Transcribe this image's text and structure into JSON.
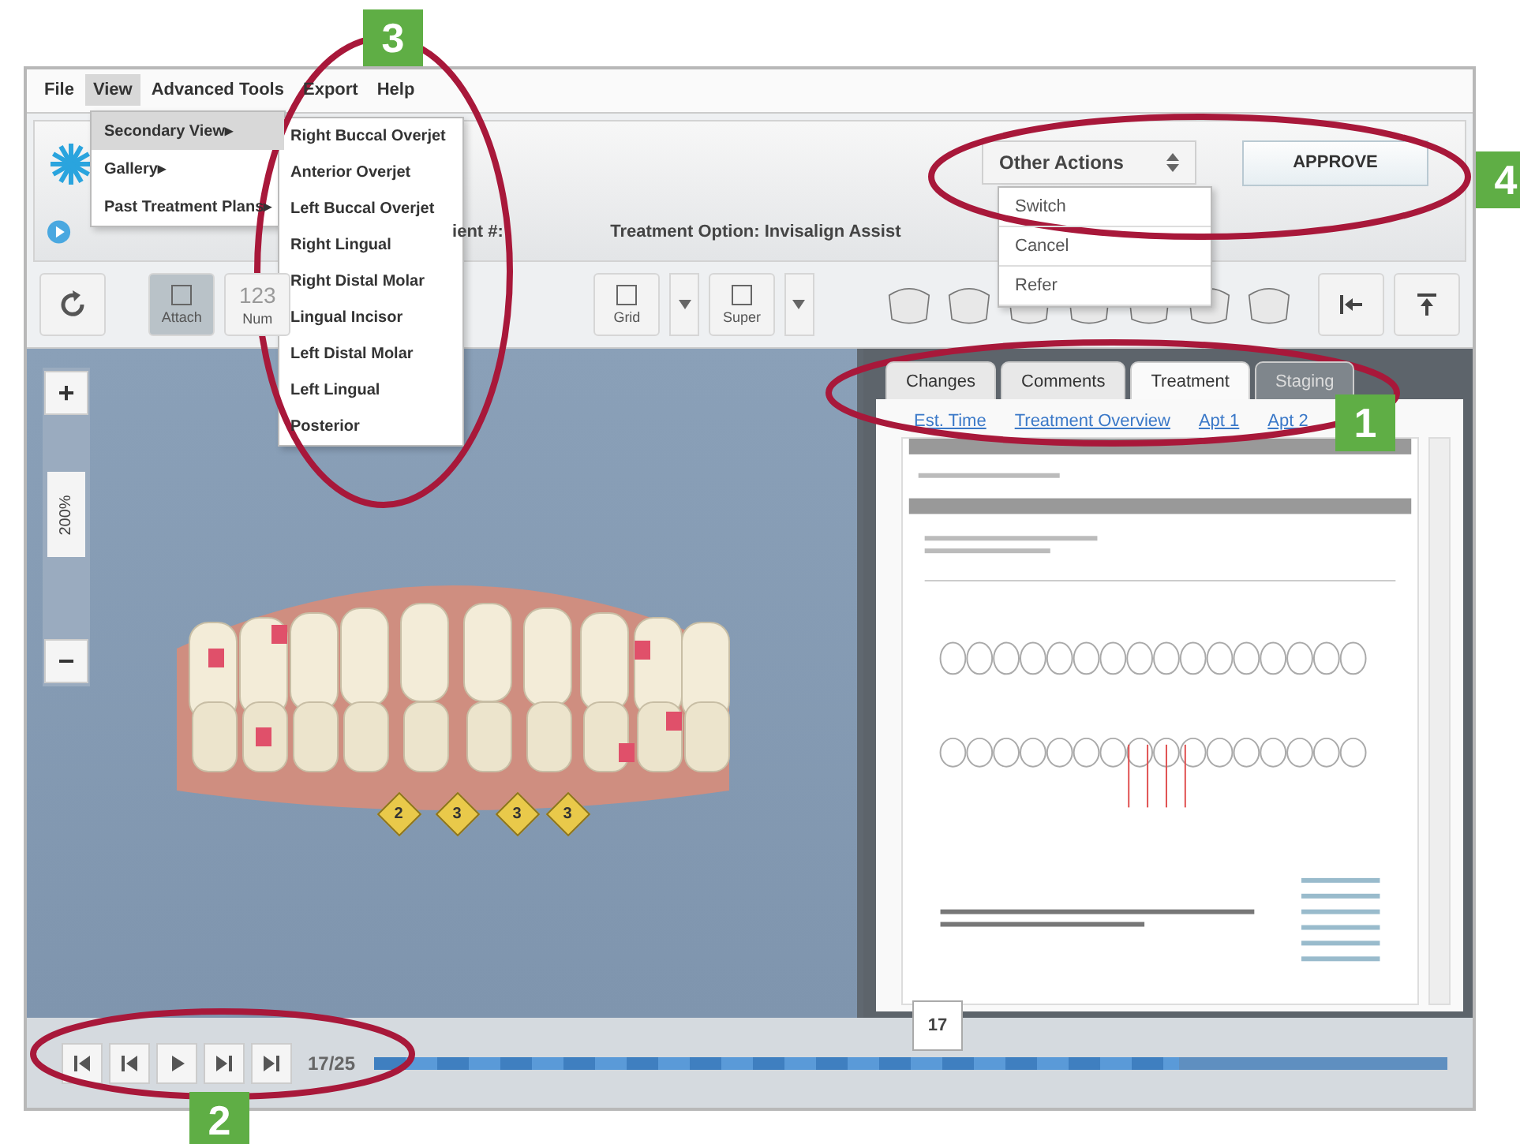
{
  "menu_bar": [
    {
      "label": "File",
      "selected": false
    },
    {
      "label": "View",
      "selected": true
    },
    {
      "label": "Advanced Tools",
      "selected": false
    },
    {
      "label": "Export",
      "selected": false
    },
    {
      "label": "Help",
      "selected": false
    }
  ],
  "view_menu": [
    {
      "label": "Secondary View",
      "arrow": "▸",
      "selected": true
    },
    {
      "label": "Gallery",
      "arrow": "▸",
      "selected": false
    },
    {
      "label": "Past Treatment Plans",
      "arrow": "▸",
      "selected": false
    }
  ],
  "secondary_view_menu": [
    "Right Buccal Overjet",
    "Anterior Overjet",
    "Left Buccal Overjet",
    "Right Lingual",
    "Right Distal Molar",
    "Lingual Incisor",
    "Left Distal Molar",
    "Left Lingual",
    "Posterior"
  ],
  "header": {
    "patient_label": "ient #:",
    "treatment_option": "Treatment Option: Invisalign Assist"
  },
  "other_actions": {
    "label": "Other Actions",
    "options": [
      "Switch",
      "Cancel",
      "Refer"
    ]
  },
  "approve": "APPROVE",
  "toolbar": [
    {
      "label": "Attach",
      "kind": "toggle",
      "selected": true
    },
    {
      "label": "Num",
      "glyph": "123",
      "kind": "toggle",
      "selected": false
    },
    {
      "label": "Grid",
      "kind": "split",
      "selected": false
    },
    {
      "label": "Super",
      "kind": "split",
      "selected": false
    }
  ],
  "zoom": {
    "plus": "+",
    "level_label": "200%",
    "level": 0.4,
    "minus": "−"
  },
  "tabs": [
    {
      "label": "Changes",
      "selected": false,
      "disabled": false
    },
    {
      "label": "Comments",
      "selected": false,
      "disabled": false
    },
    {
      "label": "Treatment",
      "selected": true,
      "disabled": false
    },
    {
      "label": "Staging",
      "selected": false,
      "disabled": true
    }
  ],
  "links": [
    "Est. Time",
    "Treatment Overview",
    "Apt 1",
    "Apt 2"
  ],
  "stage_markers": [
    "2",
    "3",
    "3",
    "3"
  ],
  "playback": {
    "position": "17/25",
    "marker": "17",
    "level": 0.75
  },
  "callouts": [
    "1",
    "2",
    "3",
    "4"
  ]
}
